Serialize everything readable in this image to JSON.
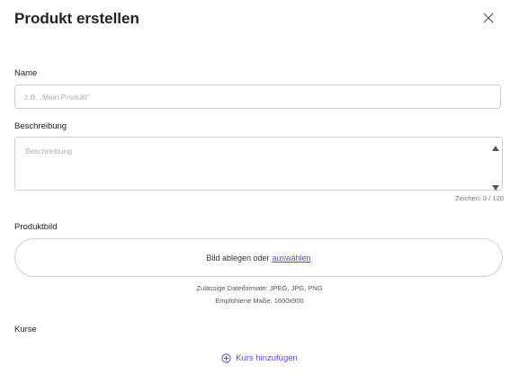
{
  "dialog": {
    "title": "Produkt erstellen"
  },
  "form": {
    "name": {
      "label": "Name",
      "value": "",
      "placeholder": "z.B. „Mein Produkt“"
    },
    "description": {
      "label": "Beschreibung",
      "value": "",
      "placeholder": "Beschreibung",
      "counter": "Zeichen: 0 / 120"
    },
    "image": {
      "label": "Produktbild",
      "drop_text": "Bild ablegen oder",
      "select_link": "auswählen",
      "formats_hint": "Zulässige Dateiformate: JPEG, JPG, PNG",
      "size_hint": "Empfohlene Maße: 1600x900"
    },
    "courses": {
      "label": "Kurse",
      "add_label": "Kurs hinzufügen"
    }
  },
  "icons": {
    "close": "close-icon",
    "add": "plus-circle-icon",
    "scroll_up": "triangle-up-icon",
    "scroll_down": "triangle-down-icon"
  },
  "colors": {
    "accent": "#5b4bd6",
    "border": "#cfcfcf",
    "placeholder": "#b0b0b0"
  }
}
